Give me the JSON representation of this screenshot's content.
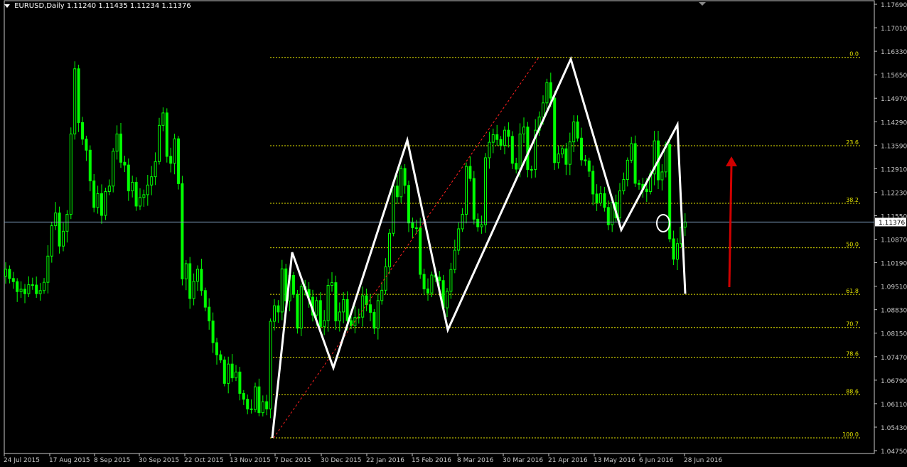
{
  "header": {
    "symbol": "EURUSD,Daily",
    "ohlc": "1.11240 1.11435 1.11234 1.11376"
  },
  "colors": {
    "background": "#000000",
    "candle": "#00ff00",
    "axis": "#c8c8c8",
    "fib": "#e6e600",
    "price_line": "#7f9fbf",
    "zigzag": "#ffffff",
    "trend": "#ff2020",
    "arrow": "#d00000"
  },
  "chart_data": {
    "type": "candlestick",
    "title": "EURUSD,Daily",
    "y_ticks": [
      "1.17690",
      "1.17010",
      "1.16330",
      "1.15650",
      "1.14970",
      "1.14290",
      "1.13590",
      "1.12910",
      "1.12230",
      "1.11550",
      "1.10870",
      "1.10190",
      "1.09510",
      "1.08830",
      "1.08150",
      "1.07470",
      "1.06790",
      "1.06110",
      "1.05430",
      "1.04750"
    ],
    "ylim": [
      1.0475,
      1.1769
    ],
    "x_ticks": [
      "24 Jul 2015",
      "17 Aug 2015",
      "8 Sep 2015",
      "30 Sep 2015",
      "22 Oct 2015",
      "13 Nov 2015",
      "7 Dec 2015",
      "30 Dec 2015",
      "22 Jan 2016",
      "15 Feb 2016",
      "8 Mar 2016",
      "30 Mar 2016",
      "21 Apr 2016",
      "13 May 2016",
      "6 Jun 2016",
      "28 Jun 2016"
    ],
    "current_price": "1.11376",
    "fibonacci_levels": [
      {
        "label": "0.0",
        "value": 1.1615
      },
      {
        "label": "23.6",
        "value": 1.1359
      },
      {
        "label": "38.2",
        "value": 1.1192
      },
      {
        "label": "50.0",
        "value": 1.1063
      },
      {
        "label": "61.8",
        "value": 1.0928
      },
      {
        "label": "70.7",
        "value": 1.0832
      },
      {
        "label": "78.6",
        "value": 1.0746
      },
      {
        "label": "88.6",
        "value": 1.0637
      },
      {
        "label": "100.0",
        "value": 1.0512
      }
    ],
    "zigzag": [
      {
        "date": "3 Dec 2015",
        "price": 1.0512
      },
      {
        "date": "11 Dec 2015",
        "price": 1.105
      },
      {
        "date": "30 Dec 2015",
        "price": 1.0715
      },
      {
        "date": "11 Feb 2016",
        "price": 1.1375
      },
      {
        "date": "3 Mar 2016",
        "price": 1.0825
      },
      {
        "date": "25 Apr 2016",
        "price": 1.161
      },
      {
        "date": "27 May 2016",
        "price": 1.1115
      },
      {
        "date": "23 Jun 2016",
        "price": 1.142
      },
      {
        "date": "24 Jun 2016",
        "price": 1.093
      }
    ],
    "closes": [
      1.1001,
      1.0974,
      1.0965,
      1.0936,
      1.0943,
      1.093,
      1.0956,
      1.0955,
      1.093,
      1.0939,
      1.0963,
      1.1039,
      1.1127,
      1.1164,
      1.1068,
      1.1111,
      1.116,
      1.1393,
      1.1582,
      1.1426,
      1.1378,
      1.1346,
      1.1257,
      1.118,
      1.122,
      1.1157,
      1.1226,
      1.1242,
      1.1343,
      1.1393,
      1.1311,
      1.1303,
      1.1228,
      1.1253,
      1.1184,
      1.1209,
      1.1217,
      1.1245,
      1.1269,
      1.1313,
      1.1418,
      1.1454,
      1.1328,
      1.1308,
      1.1379,
      1.1249,
      1.0973,
      1.1017,
      1.0916,
      1.0966,
      1.1001,
      1.0939,
      1.0891,
      1.0851,
      1.0788,
      1.0753,
      1.0738,
      1.067,
      1.0726,
      1.0686,
      1.0703,
      1.0641,
      1.0624,
      1.0596,
      1.0594,
      1.066,
      1.0585,
      1.0617,
      1.0596,
      1.085,
      1.0895,
      1.0877,
      1.1002,
      1.0909,
      1.0983,
      1.0928,
      1.083,
      1.0951,
      1.0942,
      1.092,
      1.0868,
      1.091,
      1.0835,
      1.0852,
      1.0954,
      1.0962,
      1.0851,
      1.0877,
      1.0913,
      1.0852,
      1.0837,
      1.0861,
      1.0862,
      1.0924,
      1.0898,
      1.0876,
      1.083,
      1.091,
      1.094,
      1.1008,
      1.1105,
      1.1242,
      1.1211,
      1.1293,
      1.1244,
      1.1135,
      1.1121,
      1.1121,
      1.0986,
      1.0944,
      1.0932,
      1.0984,
      1.0978,
      1.0968,
      1.0889,
      1.0937,
      1.1,
      1.1056,
      1.1118,
      1.116,
      1.1299,
      1.1264,
      1.1146,
      1.1124,
      1.113,
      1.1324,
      1.1369,
      1.1391,
      1.1377,
      1.136,
      1.1404,
      1.1386,
      1.1308,
      1.1291,
      1.1393,
      1.1413,
      1.129,
      1.129,
      1.1404,
      1.1442,
      1.1483,
      1.1542,
      1.1497,
      1.131,
      1.1335,
      1.135,
      1.1305,
      1.137,
      1.1428,
      1.1381,
      1.1318,
      1.1315,
      1.1285,
      1.1219,
      1.1193,
      1.122,
      1.118,
      1.113,
      1.1195,
      1.115,
      1.1228,
      1.1261,
      1.1317,
      1.1365,
      1.125,
      1.1247,
      1.1233,
      1.1226,
      1.1277,
      1.1373,
      1.126,
      1.1283,
      1.1362,
      1.1089,
      1.103,
      1.1075,
      1.1123,
      1.1138
    ]
  }
}
